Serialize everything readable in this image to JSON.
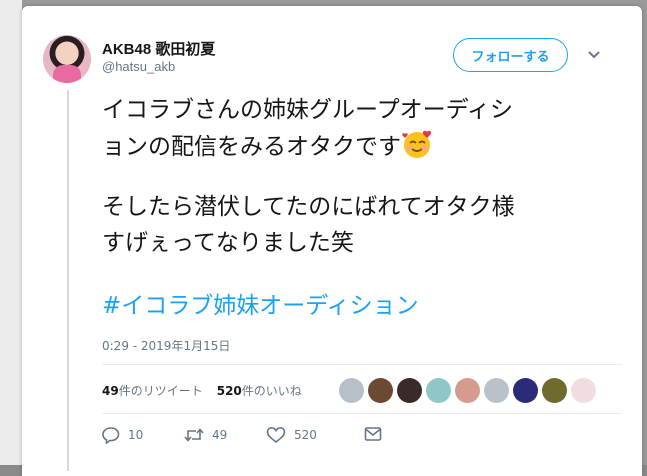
{
  "tweet": {
    "display_name": "AKB48 歌田初夏",
    "handle": "@hatsu_akb",
    "follow_label": "フォローする",
    "text_lines": [
      "イコラブさんの姉妹グループオーディシ",
      "ョンの配信をみるオタクです",
      "そしたら潜伏してたのにばれてオタク様",
      "すげぇってなりました笑"
    ],
    "hashtag": "#イコラブ姉妹オーディション",
    "timestamp": "0:29 - 2019年1月15日"
  },
  "stats": {
    "retweets_count": "49",
    "retweets_label": "件のリツイート",
    "likes_count": "520",
    "likes_label": "件のいいね"
  },
  "likers": [
    "#b7c0c8",
    "#6b4a33",
    "#3a2a2a",
    "#8fc7c7",
    "#d59b8e",
    "#b9c2c9",
    "#2c2b7a",
    "#6f6a2d",
    "#f0dde0"
  ],
  "actions": {
    "reply_count": "10",
    "retweet_count": "49",
    "like_count": "520"
  },
  "colors": {
    "accent": "#1da1f2",
    "text": "#14171a",
    "muted": "#657786"
  },
  "icons": [
    "chevron-down-icon",
    "smiling-face-with-hearts-emoji",
    "reply-icon",
    "retweet-icon",
    "heart-icon",
    "message-icon"
  ]
}
